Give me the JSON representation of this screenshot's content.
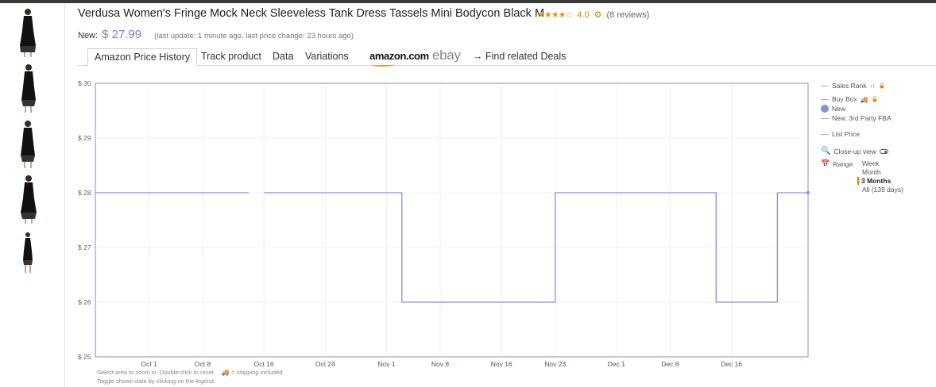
{
  "product": {
    "title": "Verdusa Women's Fringe Mock Neck Sleeveless Tank Dress Tassels Mini Bodycon Black M",
    "stars": "★★★★☆",
    "rating": "4.0",
    "reviews": "(8 reviews)"
  },
  "price": {
    "label": "New:",
    "value": "$ 27.99",
    "note": "(last update: 1 minute ago,  last price change: 23 hours ago)"
  },
  "tabs": {
    "items": [
      "Amazon Price History",
      "Track product",
      "Data",
      "Variations"
    ],
    "amazon": "amazon.com",
    "ebay": "ebay",
    "related": "→  Find related Deals"
  },
  "legend": {
    "sales_rank": "Sales Rank",
    "buy_box": "Buy Box",
    "new": "New",
    "new_3p_fba": "New, 3rd Party FBA",
    "list_price": "List Price",
    "closeup": "Close-up view",
    "range_label": "Range",
    "range_options": [
      "Week",
      "Month",
      "3 Months",
      "All (139 days)"
    ],
    "range_selected": "3 Months"
  },
  "footnote": {
    "line1": "Select area to zoom in. Double-click to reset.",
    "shipping": "= shipping included",
    "line2": "Toggle shown data by clicking on the legend."
  },
  "colors": {
    "series_new": "#8a8fd6",
    "price_text": "#7b7fd1",
    "stars": "#d89b17",
    "range_marker": "#e07a1f"
  },
  "chart_data": {
    "type": "line",
    "y_prefix": "$ ",
    "ylim": [
      25,
      30
    ],
    "y_ticks": [
      25,
      26,
      27,
      28,
      29,
      30
    ],
    "x_range": [
      "2018-09-24",
      "2018-12-26"
    ],
    "x_ticks": [
      {
        "date": "2018-10-01",
        "label": "Oct 1"
      },
      {
        "date": "2018-10-08",
        "label": "Oct 8"
      },
      {
        "date": "2018-10-16",
        "label": "Oct 16"
      },
      {
        "date": "2018-10-24",
        "label": "Oct 24"
      },
      {
        "date": "2018-11-01",
        "label": "Nov 1"
      },
      {
        "date": "2018-11-08",
        "label": "Nov 8"
      },
      {
        "date": "2018-11-16",
        "label": "Nov 16"
      },
      {
        "date": "2018-11-23",
        "label": "Nov 23"
      },
      {
        "date": "2018-12-01",
        "label": "Dec 1"
      },
      {
        "date": "2018-12-08",
        "label": "Dec 8"
      },
      {
        "date": "2018-12-16",
        "label": "Dec 16"
      }
    ],
    "grid": true,
    "legend_position": "right",
    "series": [
      {
        "name": "New",
        "step": true,
        "segments": [
          [
            {
              "x": "2018-09-24",
              "y": 28
            },
            {
              "x": "2018-10-14",
              "y": 28
            }
          ],
          [
            {
              "x": "2018-10-16",
              "y": 28
            },
            {
              "x": "2018-11-03",
              "y": 28
            },
            {
              "x": "2018-11-03",
              "y": 26
            },
            {
              "x": "2018-11-23",
              "y": 26
            },
            {
              "x": "2018-11-23",
              "y": 28
            },
            {
              "x": "2018-12-14",
              "y": 28
            },
            {
              "x": "2018-12-14",
              "y": 26
            },
            {
              "x": "2018-12-22",
              "y": 26
            },
            {
              "x": "2018-12-22",
              "y": 28
            },
            {
              "x": "2018-12-26",
              "y": 28
            }
          ]
        ]
      }
    ]
  }
}
